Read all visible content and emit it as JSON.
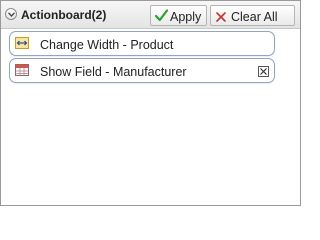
{
  "header": {
    "title": "Actionboard(2)",
    "collapse_icon": "chevron-down-circle-icon",
    "apply_label": "Apply",
    "apply_icon": "checkmark-icon",
    "clear_label": "Clear All",
    "clear_icon": "x-icon"
  },
  "items": [
    {
      "label": "Change Width - Product",
      "icon": "resize-width-icon"
    },
    {
      "label": "Show Field - Manufacturer",
      "icon": "table-field-icon",
      "remove_icon": "close-box-icon"
    }
  ],
  "colors": {
    "apply_check": "#2e9e2e",
    "clear_x": "#c0392b",
    "item_border": "#8fa5c2",
    "width_icon_fill": "#fbe3a0",
    "field_icon_header": "#d9534f"
  }
}
